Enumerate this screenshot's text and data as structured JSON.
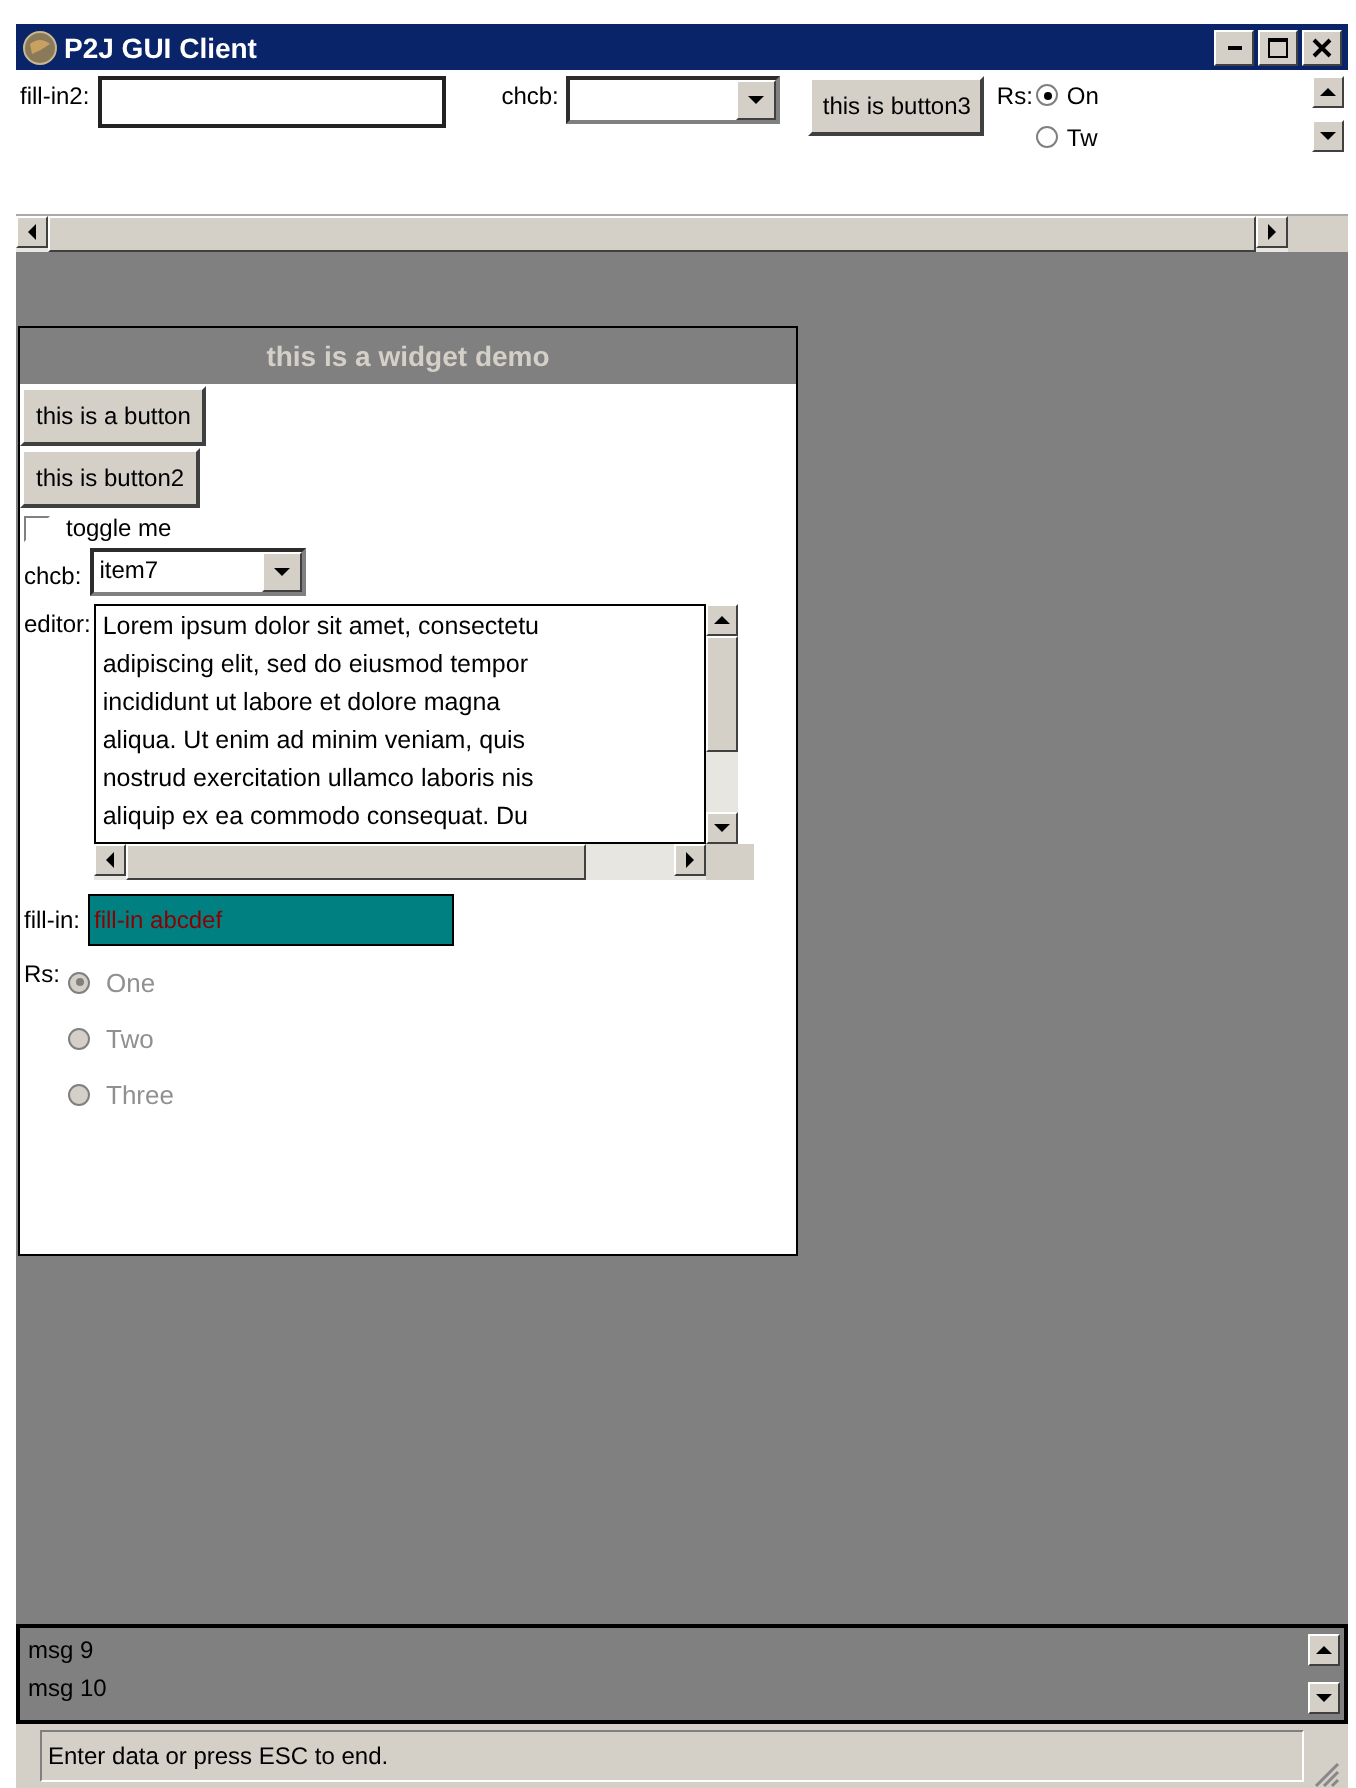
{
  "window": {
    "title": "P2J GUI Client"
  },
  "toolbar": {
    "fill_in2": {
      "label": "fill-in2:"
    },
    "chcb": {
      "label": "chcb:"
    },
    "button": "this is button3",
    "radio": {
      "label": "Rs:",
      "options": [
        {
          "label": "On",
          "selected": true
        },
        {
          "label": "Tw",
          "selected": false
        }
      ]
    }
  },
  "dialog": {
    "title": "this is a widget demo",
    "buttons": [
      "this is a button",
      "this is button2"
    ],
    "toggle": {
      "label": "toggle me",
      "checked": false
    },
    "chcb": {
      "label": "chcb:",
      "value": "item7"
    },
    "editor": {
      "label": "editor:",
      "lines": [
        "Lorem ipsum dolor sit amet, consectetu",
        "adipiscing elit, sed do eiusmod tempor",
        "incididunt ut labore et dolore magna",
        "aliqua. Ut enim ad minim veniam, quis",
        "nostrud exercitation ullamco laboris nis",
        "aliquip ex ea commodo consequat. Du"
      ]
    },
    "fill_in": {
      "label": "fill-in:",
      "value": "fill-in abcdef"
    },
    "radio": {
      "label": "Rs:",
      "disabled": true,
      "options": [
        {
          "label": "One",
          "selected": true
        },
        {
          "label": "Two",
          "selected": false
        },
        {
          "label": "Three",
          "selected": false
        }
      ]
    }
  },
  "messages": [
    "msg 9",
    "msg 10"
  ],
  "status_bar": "Enter data or press ESC to end."
}
